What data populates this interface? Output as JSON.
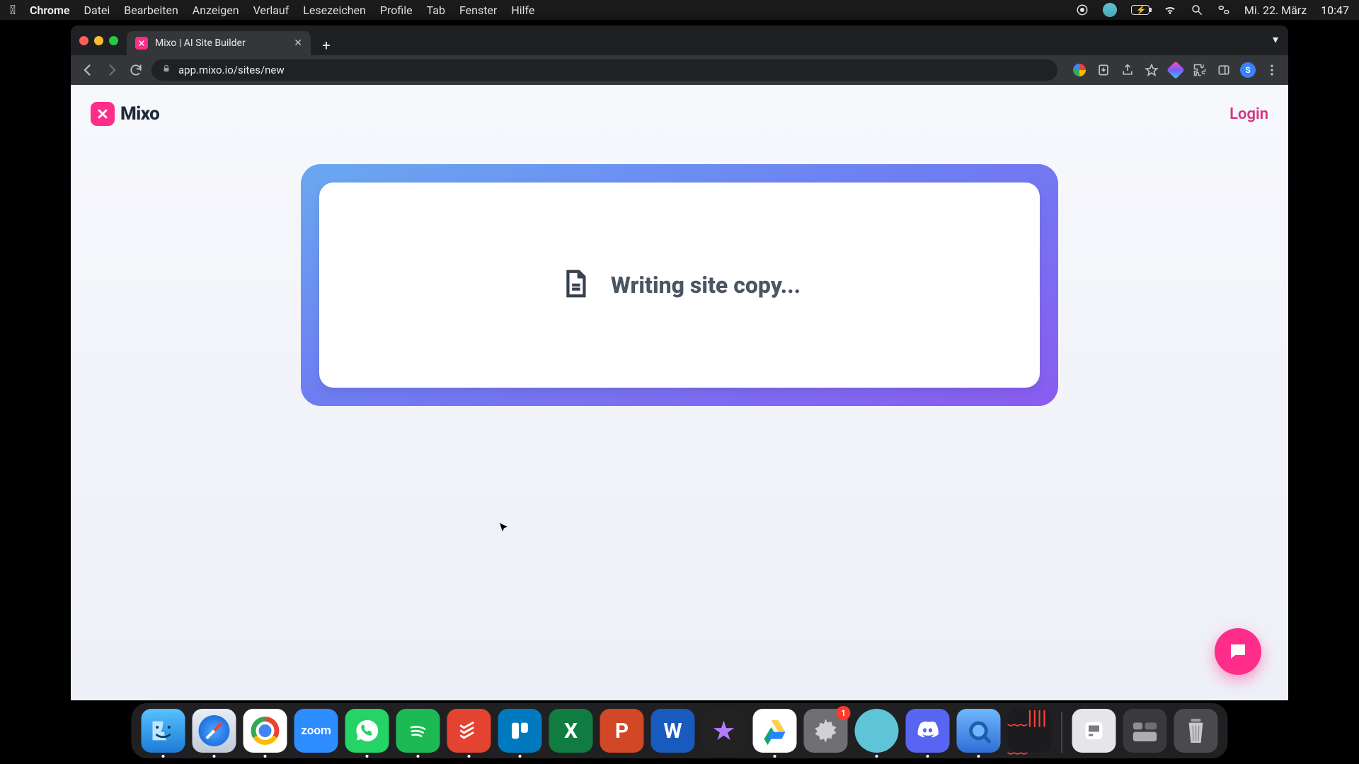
{
  "menubar": {
    "app": "Chrome",
    "items": [
      "Datei",
      "Bearbeiten",
      "Anzeigen",
      "Verlauf",
      "Lesezeichen",
      "Profile",
      "Tab",
      "Fenster",
      "Hilfe"
    ],
    "date": "Mi. 22. März",
    "time": "10:47"
  },
  "browser": {
    "tab_title": "Mixo | AI Site Builder",
    "url": "app.mixo.io/sites/new",
    "avatar_letter": "S"
  },
  "page": {
    "brand": "Mixo",
    "login": "Login",
    "status": "Writing site copy..."
  },
  "dock": {
    "items": [
      {
        "name": "finder",
        "label": "Finder",
        "running": true
      },
      {
        "name": "safari",
        "label": "Safari",
        "running": true
      },
      {
        "name": "chrome",
        "label": "Google Chrome",
        "running": true
      },
      {
        "name": "zoom",
        "label": "Zoom",
        "text": "zoom",
        "running": true
      },
      {
        "name": "whatsapp",
        "label": "WhatsApp",
        "running": true
      },
      {
        "name": "spotify",
        "label": "Spotify",
        "running": true
      },
      {
        "name": "todoist",
        "label": "Todoist",
        "running": true
      },
      {
        "name": "trello",
        "label": "Trello",
        "running": true
      },
      {
        "name": "excel",
        "label": "Excel",
        "text": "X",
        "running": true
      },
      {
        "name": "powerpoint",
        "label": "PowerPoint",
        "text": "P",
        "running": true
      },
      {
        "name": "word",
        "label": "Word",
        "text": "W",
        "running": true
      },
      {
        "name": "imovie",
        "label": "iMovie",
        "running": false
      },
      {
        "name": "gdrive",
        "label": "Google Drive",
        "running": true
      },
      {
        "name": "settings",
        "label": "System Settings",
        "badge": "1",
        "running": false
      },
      {
        "name": "circle",
        "label": "App",
        "running": true
      },
      {
        "name": "discord",
        "label": "Discord",
        "running": true
      },
      {
        "name": "quicktime",
        "label": "QuickTime",
        "running": true
      },
      {
        "name": "voicememos",
        "label": "Voice Memos",
        "running": false
      },
      {
        "name": "generic",
        "label": "App",
        "running": false
      },
      {
        "name": "folder",
        "label": "Folder",
        "running": false
      },
      {
        "name": "trash",
        "label": "Trash",
        "running": false
      }
    ]
  }
}
